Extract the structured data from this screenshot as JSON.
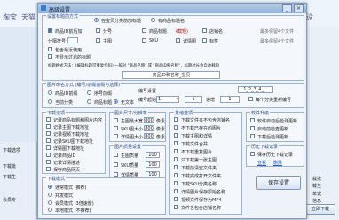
{
  "background": {
    "tabs": [
      "淘宝",
      "天猫",
      "设"
    ],
    "side_items": [
      "下载选项",
      "下载批",
      "下载生",
      "会员专"
    ],
    "side_items_right": [
      "载批",
      "载生",
      "单式",
      "信息"
    ],
    "right_button": "立即下载"
  },
  "dialog": {
    "title": "高级设置",
    "mode_label": "设置标题前方式",
    "mode_options": [
      "在宝贝分类前加标题",
      "有商品标题名",
      "宝贝标题",
      "商品名"
    ],
    "title_checks": [
      {
        "label": "商品ID前后加",
        "checked": true
      },
      {
        "label": "分号",
        "checked": false
      },
      {
        "label": "商品标题",
        "checked": false
      },
      {
        "label": "(截短)",
        "checked": false
      },
      {
        "label": "店铺名",
        "checked": false
      },
      {
        "label": "最多保留4个文件",
        "checked": false
      }
    ],
    "separator_label": "分隔符号",
    "row3_checks": [
      {
        "label": "主图",
        "checked": false
      },
      {
        "label": "SKU",
        "checked": false
      },
      {
        "label": "详情图",
        "checked": false
      },
      {
        "label": "标签",
        "checked": false
      },
      {
        "label": "最多保留4个文件",
        "checked": false
      }
    ],
    "check_recent": "包含最近使用",
    "check_filter": "不显示过滤的标题",
    "hint": "标题格式方法：(编辑标题可重复代码) 一般对 \"商品名称\" 或 \"商品ID和名称\"，标题过长会自动截短",
    "preview_value": "商品ID和名称_宝贝",
    "number_group_label": "图片命名方式 (编号/前缀前缀可选择)",
    "number_options": [
      "商品ID前缀",
      "序号前缀",
      "当前分类",
      "商品标题",
      "任务名称",
      "无文本"
    ],
    "number_label": "编号设置",
    "start_label": "编号起始",
    "start_value": "1",
    "step_label": "递增",
    "step_value": "1",
    "preview2": "1_2_3_4_...",
    "check_same": "每个分类重新编号",
    "download_options_label": "下载选项",
    "download_options": [
      "记录商品标题和图片内容",
      "记录主图下载地址",
      "记录视频下载地址",
      "记录SKU图下载地址",
      "详情图下载地址",
      "记录商品ID",
      "记录详情描述",
      "保存商品网页"
    ],
    "img_size_label": "图片尺寸/分辨率",
    "img_rows": [
      {
        "label": "主图最大宽",
        "value": "800",
        "unit": "像素"
      },
      {
        "label": "SKU图大小",
        "value": "800",
        "unit": "像素"
      },
      {
        "label": "详情图大小",
        "value": "800",
        "unit": "像素"
      }
    ],
    "img_quality_label": "图片质量设置",
    "quality_rows": [
      {
        "label": "主图质量",
        "value": "100"
      },
      {
        "label": "SKU质量",
        "value": "100"
      },
      {
        "label": "详情质量",
        "value": "100"
      }
    ],
    "misc_label": "其他选项",
    "misc_options": [
      "下载文件夹不包含店铺名",
      "不下载已存在的图片",
      "下载主图和详情",
      "下载文件合并",
      "不下载重复图片",
      "只下载第一张主图",
      "下载前清空文件夹",
      "下载完成打开文件夹",
      "下载SKU分类名称",
      "详情图片保存原始名称",
      "视频文件保存为MP4",
      "文件名包含店铺名称"
    ],
    "gif_label": "软件升级",
    "gif_options": [
      "软件启动后检测更新",
      "启动前检查更新",
      "下载后检测更新"
    ],
    "download_label": "下载模式",
    "download_modes": [
      "通常模式 (推荐)",
      "并发模式",
      "会员模式 (3倍速度)",
      "本地模式 (不推荐)"
    ],
    "history_label": "历史下载记录",
    "history_options": [
      "保存历史下载记录",
      "查看",
      "删除"
    ],
    "save_button": "保存设置",
    "hint2": "(标记)"
  }
}
